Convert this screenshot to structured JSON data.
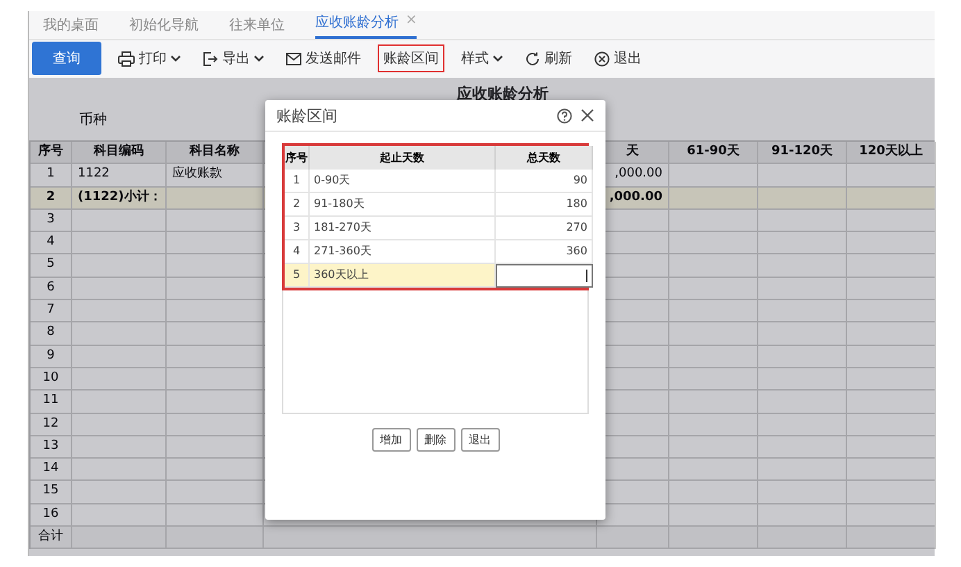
{
  "tabs": [
    {
      "label": "我的桌面",
      "selected": false,
      "closable": false
    },
    {
      "label": "初始化导航",
      "selected": false,
      "closable": false
    },
    {
      "label": "往来单位",
      "selected": false,
      "closable": false
    },
    {
      "label": "应收账龄分析",
      "selected": true,
      "closable": true,
      "close_glyph": "×"
    }
  ],
  "toolbar": [
    {
      "kind": "primary",
      "label": "查询",
      "highlighted": false
    },
    {
      "kind": "print",
      "label": "打印",
      "dropdown": true,
      "highlighted": false
    },
    {
      "kind": "export",
      "label": "导出",
      "dropdown": true,
      "highlighted": false
    },
    {
      "kind": "mail",
      "label": "发送邮件",
      "dropdown": false,
      "highlighted": false
    },
    {
      "kind": "plain",
      "label": "账龄区间",
      "dropdown": false,
      "highlighted": true
    },
    {
      "kind": "plain",
      "label": "样式",
      "dropdown": true,
      "highlighted": false
    },
    {
      "kind": "refresh",
      "label": "刷新",
      "dropdown": false,
      "highlighted": false
    },
    {
      "kind": "exit",
      "label": "退出",
      "dropdown": false,
      "highlighted": false
    }
  ],
  "report": {
    "title": "应收账龄分析",
    "currency_label": "币种",
    "columns": [
      "序号",
      "科目编码",
      "科目名称",
      "",
      "天",
      "61-90天",
      "91-120天",
      "120天以上"
    ],
    "rows": [
      {
        "cells": [
          "1",
          "1122",
          "应收账款",
          "",
          ",000.00",
          "",
          "",
          ""
        ],
        "subtotal": false
      },
      {
        "cells": [
          "2",
          "(1122)小计：",
          "",
          "",
          ",000.00",
          "",
          "",
          ""
        ],
        "subtotal": true
      },
      {
        "cells": [
          "3",
          "",
          "",
          "",
          "",
          "",
          "",
          ""
        ],
        "subtotal": false
      },
      {
        "cells": [
          "4",
          "",
          "",
          "",
          "",
          "",
          "",
          ""
        ],
        "subtotal": false
      },
      {
        "cells": [
          "5",
          "",
          "",
          "",
          "",
          "",
          "",
          ""
        ],
        "subtotal": false
      },
      {
        "cells": [
          "6",
          "",
          "",
          "",
          "",
          "",
          "",
          ""
        ],
        "subtotal": false
      },
      {
        "cells": [
          "7",
          "",
          "",
          "",
          "",
          "",
          "",
          ""
        ],
        "subtotal": false
      },
      {
        "cells": [
          "8",
          "",
          "",
          "",
          "",
          "",
          "",
          ""
        ],
        "subtotal": false
      },
      {
        "cells": [
          "9",
          "",
          "",
          "",
          "",
          "",
          "",
          ""
        ],
        "subtotal": false
      },
      {
        "cells": [
          "10",
          "",
          "",
          "",
          "",
          "",
          "",
          ""
        ],
        "subtotal": false
      },
      {
        "cells": [
          "11",
          "",
          "",
          "",
          "",
          "",
          "",
          ""
        ],
        "subtotal": false
      },
      {
        "cells": [
          "12",
          "",
          "",
          "",
          "",
          "",
          "",
          ""
        ],
        "subtotal": false
      },
      {
        "cells": [
          "13",
          "",
          "",
          "",
          "",
          "",
          "",
          ""
        ],
        "subtotal": false
      },
      {
        "cells": [
          "14",
          "",
          "",
          "",
          "",
          "",
          "",
          ""
        ],
        "subtotal": false
      },
      {
        "cells": [
          "15",
          "",
          "",
          "",
          "",
          "",
          "",
          ""
        ],
        "subtotal": false
      },
      {
        "cells": [
          "16",
          "",
          "",
          "",
          "",
          "",
          "",
          ""
        ],
        "subtotal": false
      }
    ],
    "total_label": "合计"
  },
  "dialog": {
    "title": "账龄区间",
    "columns": [
      "序号",
      "起止天数",
      "总天数"
    ],
    "rows": [
      {
        "no": "1",
        "range": "0-90天",
        "days": "90",
        "selected": false,
        "editing": false
      },
      {
        "no": "2",
        "range": "91-180天",
        "days": "180",
        "selected": false,
        "editing": false
      },
      {
        "no": "3",
        "range": "181-270天",
        "days": "270",
        "selected": false,
        "editing": false
      },
      {
        "no": "4",
        "range": "271-360天",
        "days": "360",
        "selected": false,
        "editing": false
      },
      {
        "no": "5",
        "range": "360天以上",
        "days": "",
        "selected": true,
        "editing": true
      }
    ],
    "buttons": [
      "增加",
      "删除",
      "退出"
    ]
  }
}
